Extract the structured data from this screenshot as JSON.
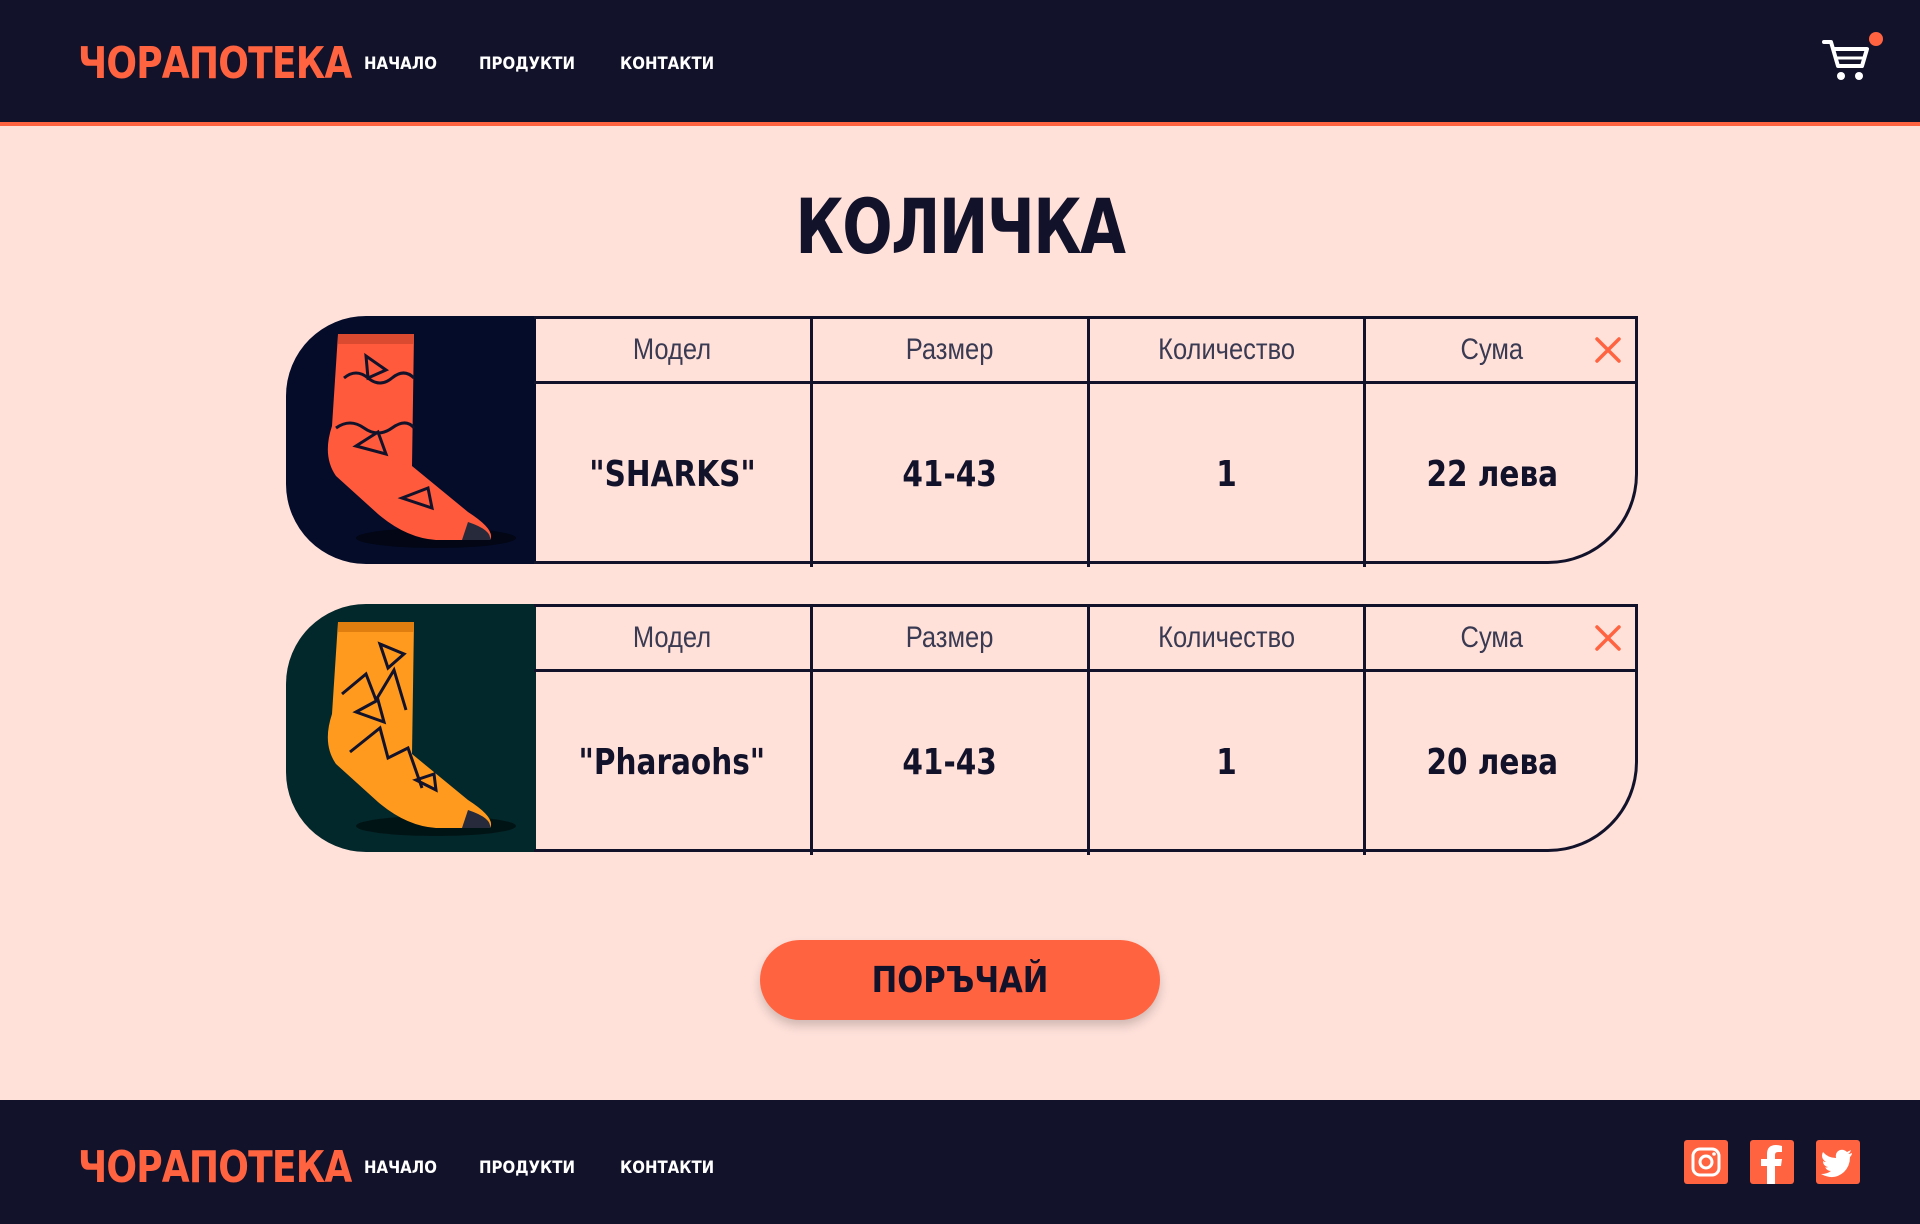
{
  "brand": {
    "logo_text": "ЧОРАПОТЕКА"
  },
  "nav": {
    "items": [
      {
        "label": "НАЧАЛО"
      },
      {
        "label": "ПРОДУКТИ"
      },
      {
        "label": "КОНТАКТИ"
      }
    ]
  },
  "page": {
    "title": "КОЛИЧКА"
  },
  "table_headers": {
    "model": "Модел",
    "size": "Размер",
    "quantity": "Количество",
    "sum": "Сума"
  },
  "cart_items": [
    {
      "model": "\"SHARKS\"",
      "size": "41-43",
      "quantity": "1",
      "sum": "22 лева",
      "sock_color": "#ff5a3c",
      "photo_bg": "#040c2a"
    },
    {
      "model": "\"Pharaohs\"",
      "size": "41-43",
      "quantity": "1",
      "sum": "20 лева",
      "sock_color": "#ff9a1f",
      "photo_bg": "#03282b"
    }
  ],
  "order_button": {
    "label": "ПОРЪЧАЙ"
  },
  "footer": {
    "logo_text": "ЧОРАПОТЕКА",
    "nav": [
      {
        "label": "НАЧАЛО"
      },
      {
        "label": "ПРОДУКТИ"
      },
      {
        "label": "КОНТАКТИ"
      }
    ],
    "social": [
      "instagram-icon",
      "facebook-icon",
      "twitter-icon"
    ]
  },
  "colors": {
    "accent": "#ff6340",
    "dark": "#12122b",
    "background": "#ffe1da"
  }
}
